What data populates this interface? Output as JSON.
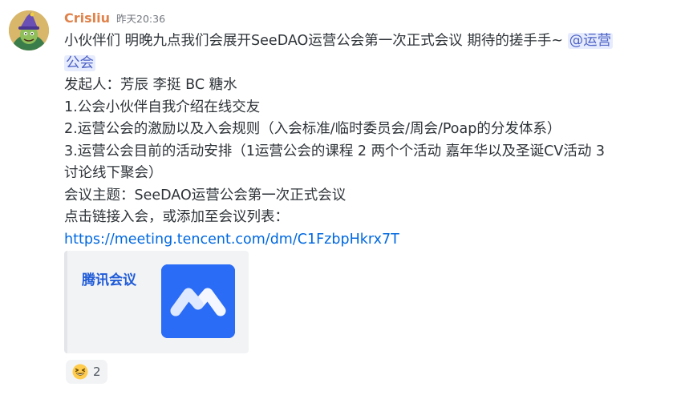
{
  "message": {
    "username": "Crisliu",
    "timestamp": "昨天20:36",
    "line1_text": "小伙伴们 明晚九点我们会展开SeeDAO运营公会第一次正式会议  期待的搓手手~ ",
    "mention_part1": "@运营",
    "mention_part2": "公会",
    "lines": [
      "发起人：芳辰 李挺 BC 糖水",
      "1.公会小伙伴自我介绍在线交友",
      "2.运营公会的激励以及入会规则（入会标准/临时委员会/周会/Poap的分发体系）",
      "3.运营公会目前的活动安排（1运营公会的课程 2 两个个活动 嘉年华以及圣诞CV活动 3",
      "讨论线下聚会）",
      "会议主题：SeeDAO运营公会第一次正式会议",
      "点击链接入会，或添加至会议列表："
    ],
    "link": "https://meeting.tencent.com/dm/C1FzbpHkrx7T"
  },
  "embed": {
    "title": "腾讯会议",
    "thumbnail_icon": "tencent-meeting-logo-icon",
    "thumbnail_color": "#2b6cf6"
  },
  "reaction": {
    "emoji": "grinning-squinting-face-icon",
    "count": "2"
  },
  "colors": {
    "username": "#e0824a",
    "link": "#0068e0",
    "mention_bg": "#e6ecfd",
    "mention_text": "#4f63c7"
  }
}
